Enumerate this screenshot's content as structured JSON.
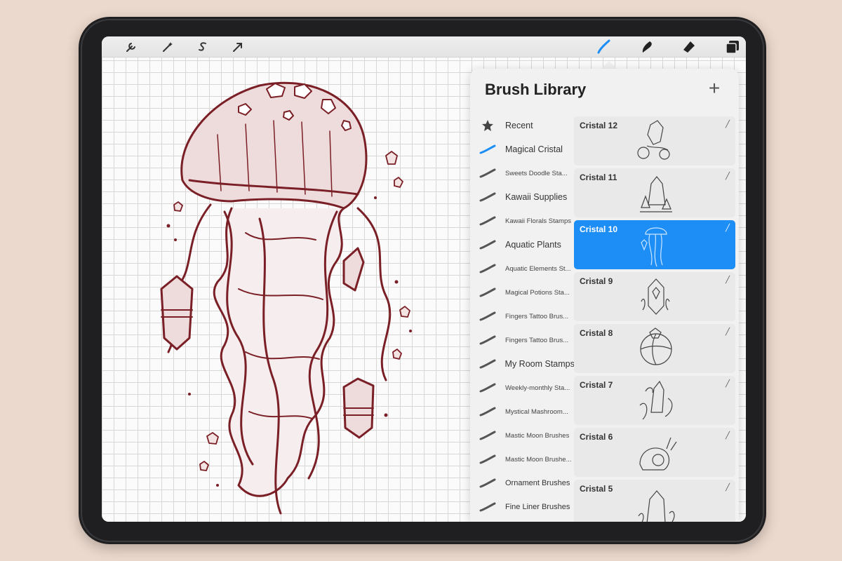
{
  "toolbar": {
    "left_icons": [
      "wrench-icon",
      "magic-wand-icon",
      "selection-s-icon",
      "arrow-cursor-icon"
    ],
    "right_icons": [
      "brush-icon",
      "smudge-icon",
      "eraser-icon",
      "layers-icon"
    ],
    "active_tool": "brush-icon",
    "accent": "#1e8ef7"
  },
  "library": {
    "title": "Brush Library",
    "add_label": "+",
    "categories": [
      {
        "label": "Recent",
        "icon": "star-icon"
      },
      {
        "label": "Magical Cristal",
        "icon": "brush-stroke-icon",
        "active": true
      },
      {
        "label": "Sweets Doodle Sta...",
        "icon": "brush-stroke-icon"
      },
      {
        "label": "Kawaii Supplies",
        "icon": "brush-stroke-icon"
      },
      {
        "label": "Kawaii Florals Stamps",
        "icon": "brush-stroke-icon"
      },
      {
        "label": "Aquatic Plants",
        "icon": "brush-stroke-icon"
      },
      {
        "label": "Aquatic Elements St...",
        "icon": "brush-stroke-icon"
      },
      {
        "label": "Magical Potions Sta...",
        "icon": "brush-stroke-icon"
      },
      {
        "label": "Fingers Tattoo Brus...",
        "icon": "brush-stroke-icon"
      },
      {
        "label": "Fingers Tattoo Brus...",
        "icon": "brush-stroke-icon"
      },
      {
        "label": "My Room Stamps",
        "icon": "brush-stroke-icon"
      },
      {
        "label": "Weekly-monthly Sta...",
        "icon": "brush-stroke-icon"
      },
      {
        "label": "Mystical Mashroom...",
        "icon": "brush-stroke-icon"
      },
      {
        "label": "Mastic Moon Brushes",
        "icon": "brush-stroke-icon"
      },
      {
        "label": "Mastic Moon Brushe...",
        "icon": "brush-stroke-icon"
      },
      {
        "label": "Ornament Brushes",
        "icon": "brush-stroke-icon"
      },
      {
        "label": "Fine Liner Brushes",
        "icon": "brush-stroke-icon"
      }
    ],
    "brushes": [
      {
        "name": "Cristal 12",
        "selected": false
      },
      {
        "name": "Cristal 11",
        "selected": false
      },
      {
        "name": "Cristal 10",
        "selected": true
      },
      {
        "name": "Cristal 9",
        "selected": false
      },
      {
        "name": "Cristal 8",
        "selected": false
      },
      {
        "name": "Cristal 7",
        "selected": false
      },
      {
        "name": "Cristal 6",
        "selected": false
      },
      {
        "name": "Cristal 5",
        "selected": false
      }
    ]
  },
  "artwork": {
    "subject": "jellyfish-illustration",
    "line_color": "#7a1f26",
    "fill_color": "#e9d3d3"
  }
}
